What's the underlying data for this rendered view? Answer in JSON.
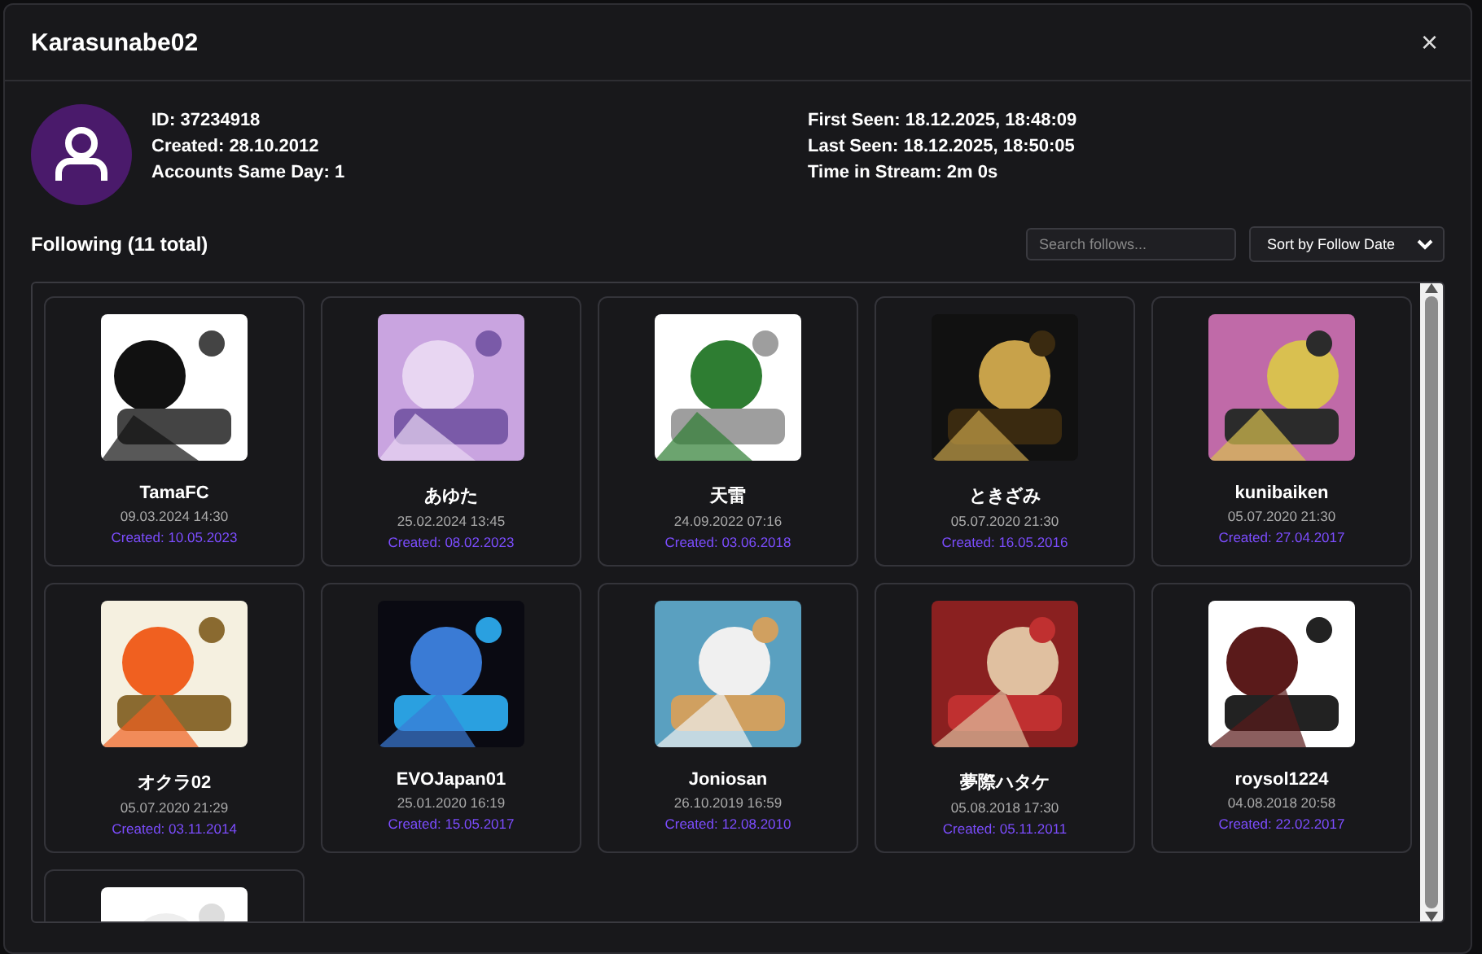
{
  "dialog": {
    "title": "Karasunabe02",
    "close": "×"
  },
  "profile": {
    "left": [
      {
        "label": "ID:",
        "value": "37234918"
      },
      {
        "label": "Created:",
        "value": "28.10.2012"
      },
      {
        "label": "Accounts Same Day:",
        "value": "1"
      }
    ],
    "right": [
      {
        "label": "First Seen:",
        "value": "18.12.2025, 18:48:09"
      },
      {
        "label": "Last Seen:",
        "value": "18.12.2025, 18:50:05"
      },
      {
        "label": "Time in Stream:",
        "value": "2m 0s"
      }
    ]
  },
  "following": {
    "heading": "Following (11 total)",
    "search": {
      "placeholder": "Search follows..."
    },
    "sort": {
      "value": "Sort by Follow Date"
    },
    "items": [
      {
        "name": "TamaFC",
        "followed": "09.03.2024 14:30",
        "created": "Created: 10.05.2023"
      },
      {
        "name": "あゆた",
        "followed": "25.02.2024 13:45",
        "created": "Created: 08.02.2023"
      },
      {
        "name": "天雷",
        "followed": "24.09.2022 07:16",
        "created": "Created: 03.06.2018"
      },
      {
        "name": "ときざみ",
        "followed": "05.07.2020 21:30",
        "created": "Created: 16.05.2016"
      },
      {
        "name": "kunibaiken",
        "followed": "05.07.2020 21:30",
        "created": "Created: 27.04.2017"
      },
      {
        "name": "オクラ02",
        "followed": "05.07.2020 21:29",
        "created": "Created: 03.11.2014"
      },
      {
        "name": "EVOJapan01",
        "followed": "25.01.2020 16:19",
        "created": "Created: 15.05.2017"
      },
      {
        "name": "Joniosan",
        "followed": "26.10.2019 16:59",
        "created": "Created: 12.08.2010"
      },
      {
        "name": "夢際ハタケ",
        "followed": "05.08.2018 17:30",
        "created": "Created: 05.11.2011"
      },
      {
        "name": "roysol1224",
        "followed": "04.08.2018 20:58",
        "created": "Created: 22.02.2017"
      },
      {
        "kind": "partial"
      }
    ]
  }
}
